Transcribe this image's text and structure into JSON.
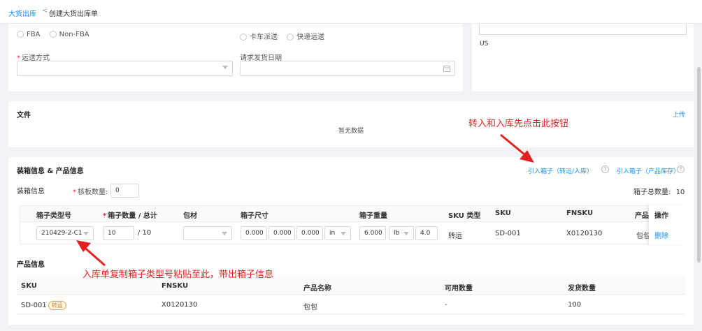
{
  "breadcrumb": {
    "parent": "大货出库",
    "separator": "<",
    "current": "创建大货出库单"
  },
  "form": {
    "fba_options": [
      "FBA",
      "Non-FBA"
    ],
    "delivery_options": [
      "卡车派送",
      "快递运送"
    ],
    "shipping_method": {
      "label": "运送方式",
      "required": true,
      "value": ""
    },
    "request_date": {
      "label": "请求发货日期",
      "value": ""
    },
    "country_text": "US"
  },
  "files": {
    "title": "文件",
    "upload_label": "上传",
    "empty_text": "暂无数据"
  },
  "packing": {
    "title": "装箱信息 & 产品信息",
    "import_transfer_label": "引入箱子（转运/入库）",
    "import_stock_label": "引入箱子（产品库存）",
    "info_label": "装箱信息",
    "pallet_label": "核板数量:",
    "pallet_value": "0",
    "total_boxes_label": "箱子总数量:",
    "total_boxes_value": "10",
    "table_headers": [
      "箱子类型号",
      "箱子数量 / 总计",
      "包材",
      "箱子尺寸",
      "箱子重量",
      "SKU 类型",
      "SKU",
      "FNSKU",
      "产品",
      "操作"
    ],
    "row": {
      "box_type": "210429-2-C1",
      "qty": "10",
      "total": "/ 10",
      "material": "",
      "dim_l": "0.000",
      "dim_w": "0.000",
      "dim_h": "0.000",
      "dim_unit": "in",
      "weight": "6.000",
      "weight_unit": "lb",
      "weight_extra": "4.0",
      "sku_type": "转运",
      "sku": "SD-001",
      "fnsku": "X0120130",
      "product": "包包",
      "action": "删除"
    }
  },
  "product_info": {
    "title": "产品信息",
    "headers": [
      "SKU",
      "FNSKU",
      "产品名称",
      "可用数量",
      "发货数量"
    ],
    "row": {
      "sku": "SD-001",
      "tag": "转运",
      "fnsku": "X0120130",
      "name": "包包",
      "available": "-",
      "ship_qty": "100"
    }
  },
  "annotations": {
    "top": "转入和入库先点击此按钮",
    "bottom": "入库单复制箱子类型号粘贴至此，带出箱子信息",
    "color": "#e32020"
  }
}
